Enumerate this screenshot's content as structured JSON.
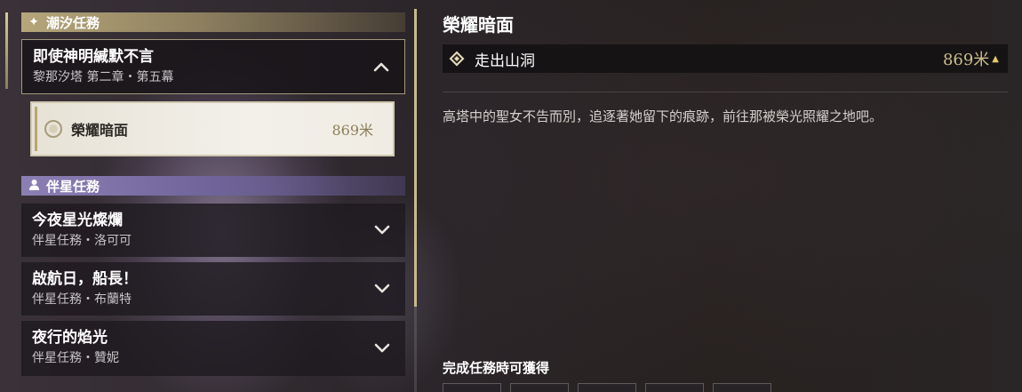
{
  "left": {
    "categories": [
      {
        "label": "潮汐任務",
        "icon": "sparkle-icon"
      },
      {
        "label": "伴星任務",
        "icon": "person-icon"
      }
    ],
    "tide_quest": {
      "title": "即使神明緘默不言",
      "subtitle": "黎那汐塔 第二章・第五幕",
      "expanded": true,
      "sub_item": {
        "label": "榮耀暗面",
        "distance": "869米"
      }
    },
    "companion_quests": [
      {
        "title": "今夜星光燦爛",
        "subtitle": "伴星任務・洛可可"
      },
      {
        "title": "啟航日，船長！",
        "subtitle": "伴星任務・布蘭特"
      },
      {
        "title": "夜行的焰光",
        "subtitle": "伴星任務・贊妮"
      }
    ]
  },
  "detail": {
    "title": "榮耀暗面",
    "objective": {
      "label": "走出山洞",
      "distance": "869米",
      "arrow": "▲"
    },
    "description": "高塔中的聖女不告而別，追逐著她留下的痕跡，前往那被榮光照耀之地吧。",
    "rewards_label": "完成任務時可獲得",
    "reward_slots": 5
  },
  "colors": {
    "gold_accent": "#b6a67a",
    "purple_accent": "#8c7fb4",
    "distance_gold": "#cdbd8c"
  }
}
